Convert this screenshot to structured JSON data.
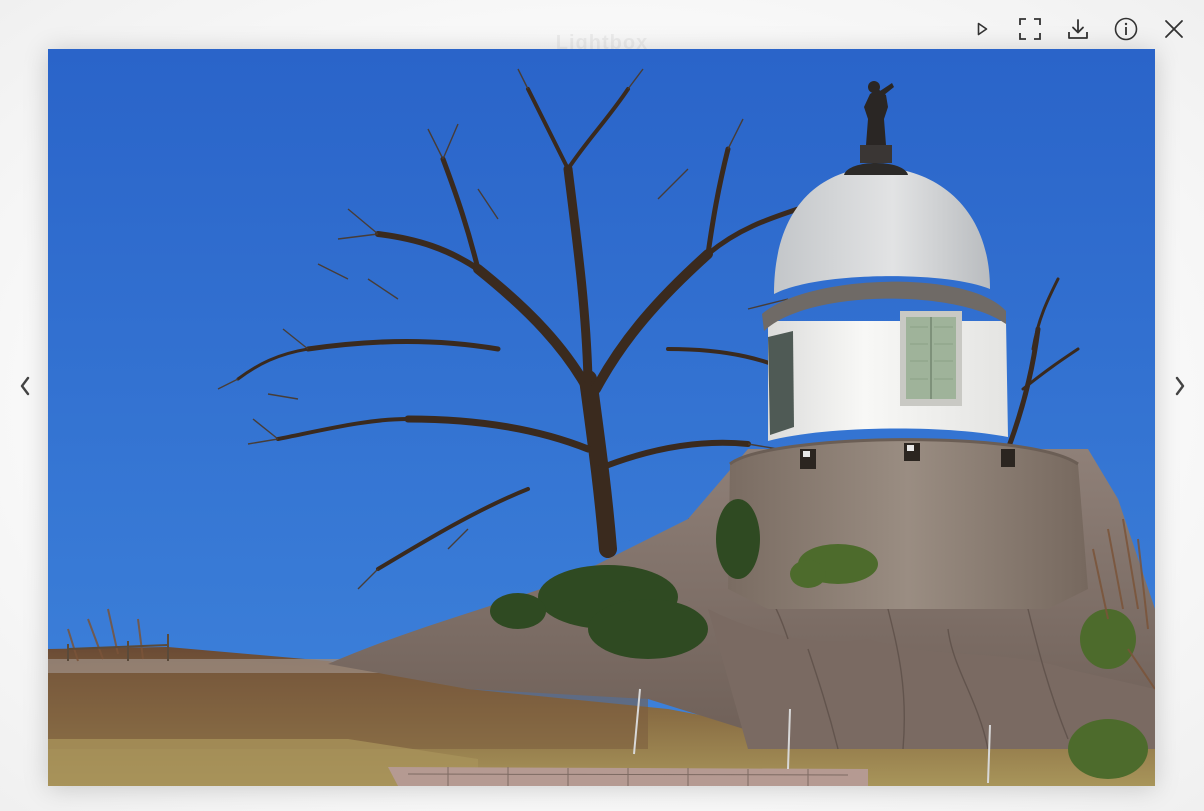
{
  "viewer": {
    "title": "Lightbox",
    "toolbar": [
      {
        "name": "slideshow-play-button",
        "icon": "play-icon"
      },
      {
        "name": "fullscreen-button",
        "icon": "fullscreen-icon"
      },
      {
        "name": "download-button",
        "icon": "download-icon"
      },
      {
        "name": "info-button",
        "icon": "info-icon"
      },
      {
        "name": "close-button",
        "icon": "close-icon"
      }
    ],
    "nav": {
      "prev_icon": "chevron-left-icon",
      "next_icon": "chevron-right-icon"
    },
    "photo": {
      "subject": "photo"
    }
  },
  "colors": {
    "icon": "#333333",
    "sky_top": "#2a64c9",
    "sky_bottom": "#3e82db",
    "stone": "#8a7c72",
    "dome": "#d6d8da",
    "wall": "#f4f4f2"
  }
}
